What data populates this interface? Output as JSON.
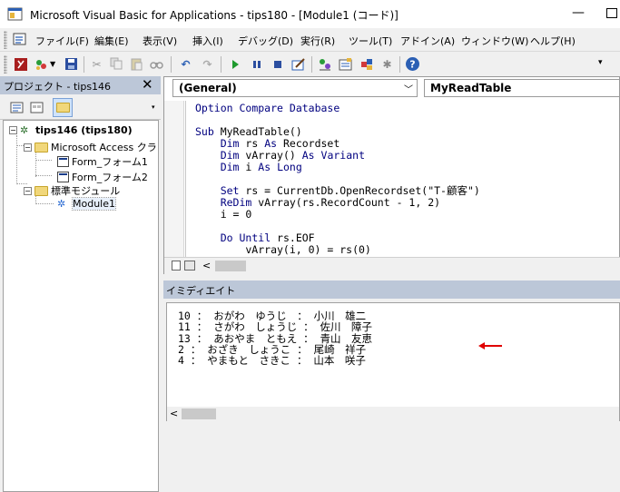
{
  "window": {
    "title": "Microsoft Visual Basic for Applications - tips180 - [Module1 (コード)]",
    "minimize_glyph": "—"
  },
  "menu": {
    "items": [
      "ファイル(F)",
      "編集(E)",
      "表示(V)",
      "挿入(I)",
      "デバッグ(D)",
      "実行(R)",
      "ツール(T)",
      "アドイン(A)",
      "ウィンドウ(W)",
      "ヘルプ(H)"
    ]
  },
  "toolbar": {
    "icons": [
      "excel-icon",
      "insert-module-icon",
      "save-icon",
      "cut-icon",
      "copy-icon",
      "paste-icon",
      "find-icon",
      "undo-icon",
      "redo-icon",
      "run-icon",
      "break-icon",
      "reset-icon",
      "design-mode-icon",
      "project-explorer-icon",
      "properties-icon",
      "object-browser-icon",
      "toolbox-icon",
      "help-icon"
    ]
  },
  "project": {
    "title": "プロジェクト - tips146",
    "close_glyph": "✕",
    "tree": {
      "root": "tips146 (tips180)",
      "folder_access": "Microsoft Access クラ",
      "forms": [
        "Form_フォーム1",
        "Form_フォーム2"
      ],
      "folder_modules": "標準モジュール",
      "module": "Module1"
    }
  },
  "code_window": {
    "object_combo": "(General)",
    "procedure_combo": "MyReadTable",
    "lines": [
      "Option Compare Database",
      "",
      "Sub MyReadTable()",
      "    Dim rs As Recordset",
      "    Dim vArray() As Variant",
      "    Dim i As Long",
      "",
      "    Set rs = CurrentDb.OpenRecordset(\"T-顧客\")",
      "    ReDim vArray(rs.RecordCount - 1, 2)",
      "    i = 0",
      "",
      "    Do Until rs.EOF",
      "        vArray(i, 0) = rs(0)"
    ]
  },
  "immediate": {
    "title": "イミディエイト",
    "lines": [
      "10 ： おがわ　ゆうじ　： 小川　雄二",
      "11 ： さがわ　しょうじ ： 佐川　障子",
      "13 ： あおやま　ともえ ： 青山　友恵",
      "2 ： おざき　しょうこ ： 尾崎　祥子",
      "4 ： やまもと　さきこ ： 山本　咲子"
    ]
  },
  "colors": {
    "keyword": "#00007f",
    "annotation_arrow": "#e00000",
    "panel_header": "#bcc7d8"
  }
}
